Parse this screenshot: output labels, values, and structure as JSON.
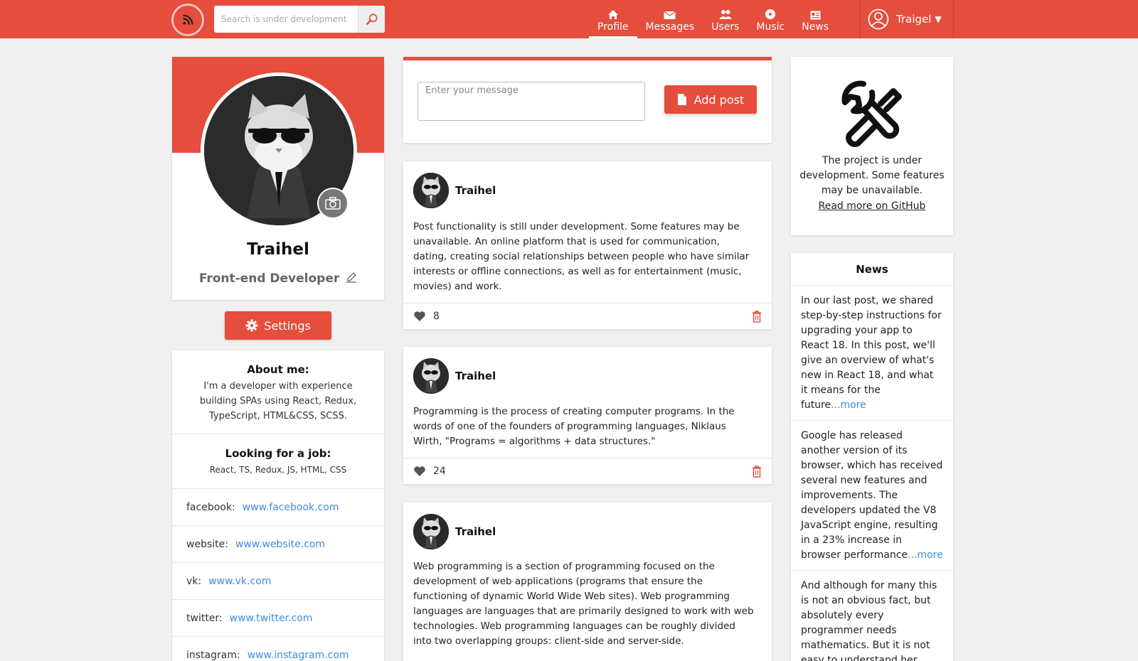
{
  "header": {
    "search_placeholder": "Search is under development",
    "nav": [
      {
        "label": "Profile",
        "icon": "home-icon",
        "active": true
      },
      {
        "label": "Messages",
        "icon": "envelope-icon",
        "active": false
      },
      {
        "label": "Users",
        "icon": "users-icon",
        "active": false
      },
      {
        "label": "Music",
        "icon": "music-icon",
        "active": false
      },
      {
        "label": "News",
        "icon": "news-icon",
        "active": false
      }
    ],
    "user_name": "Traigel",
    "caret": "▼"
  },
  "profile": {
    "name": "Traihel",
    "role": "Front-end Developer",
    "settings_label": "Settings"
  },
  "info": {
    "about_title": "About me:",
    "about_text": "I'm a developer with experience building SPAs using React, Redux, TypeScript, HTML&CSS, SCSS.",
    "job_title": "Looking for a job:",
    "job_text": "React, TS, Redux, JS, HTML, CSS",
    "links": [
      {
        "label": "facebook:",
        "url": "www.facebook.com"
      },
      {
        "label": "website:",
        "url": "www.website.com"
      },
      {
        "label": "vk:",
        "url": "www.vk.com"
      },
      {
        "label": "twitter:",
        "url": "www.twitter.com"
      },
      {
        "label": "instagram:",
        "url": "www.instagram.com"
      }
    ]
  },
  "composer": {
    "placeholder": "Enter your message",
    "add_label": "Add post"
  },
  "posts": [
    {
      "author": "Traihel",
      "text": "Post functionality is still under development. Some features may be unavailable. An online platform that is used for communication, dating, creating social relationships between people who have similar interests or offline connections, as well as for entertainment (music, movies) and work.",
      "likes": "8"
    },
    {
      "author": "Traihel",
      "text": "Programming is the process of creating computer programs. In the words of one of the founders of programming languages, Niklaus Wirth, \"Programs = algorithms + data structures.\"",
      "likes": "24"
    },
    {
      "author": "Traihel",
      "text": "Web programming is a section of programming focused on the development of web applications (programs that ensure the functioning of dynamic World Wide Web sites). Web programming languages are languages that are primarily designed to work with web technologies. Web programming languages can be roughly divided into two overlapping groups: client-side and server-side.",
      "likes": ""
    }
  ],
  "dev_notice": {
    "text": "The project is under development. Some features may be unavailable.",
    "link": "Read more on GitHub"
  },
  "news": {
    "title": "News",
    "items": [
      {
        "text": "In our last post, we shared step-by-step instructions for upgrading your app to React 18. In this post, we'll give an overview of what's new in React 18, and what it means for the future",
        "more": "...more"
      },
      {
        "text": "Google has released another version of its browser, which has received several new features and improvements. The developers updated the V8 JavaScript engine, resulting in a 23% increase in browser performance",
        "more": "...more"
      },
      {
        "text": "And although for many this is not an obvious fact, but absolutely every programmer needs mathematics. But it is not easy to understand her. Probably everyone",
        "more": ""
      }
    ]
  },
  "colors": {
    "accent": "#e54d3c",
    "link": "#3d8be0",
    "background": "#f0f0f0"
  }
}
